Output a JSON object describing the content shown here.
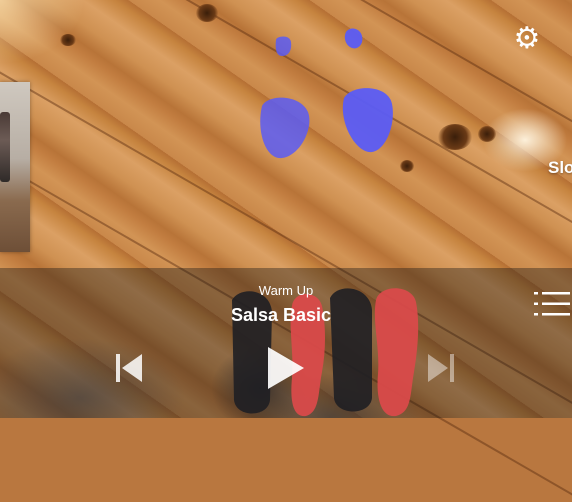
{
  "scene": {
    "overlay_text": "Slo"
  },
  "player": {
    "subtitle": "Warm Up",
    "title": "Salsa Basic"
  },
  "icons": {
    "settings": "gear-icon",
    "previous": "skip-previous-icon",
    "play": "play-icon",
    "next": "skip-next-icon",
    "playlist": "list-icon"
  },
  "colors": {
    "footprint_blue": "#5b5cf5",
    "footprint_red": "#d94a4a",
    "control": "#ffffff"
  }
}
